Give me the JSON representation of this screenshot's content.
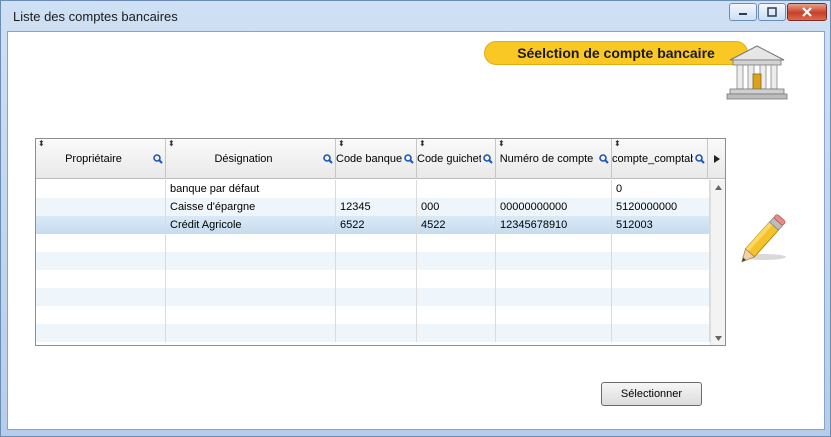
{
  "window": {
    "title": "Liste des comptes bancaires"
  },
  "banner": {
    "text": "Séelction de compte bancaire"
  },
  "grid": {
    "columns": [
      "Propriétaire",
      "Désignation",
      "Code banque",
      "Code guichet",
      "Numéro de compte",
      "compte_comptable"
    ],
    "rows": [
      [
        "",
        "banque par défaut",
        "",
        "",
        "",
        "0"
      ],
      [
        "",
        "Caisse d'épargne",
        "12345",
        "000",
        "00000000000",
        "5120000000"
      ],
      [
        "",
        "Crédit Agricole",
        "6522",
        "4522",
        "12345678910",
        "512003"
      ]
    ],
    "selected_row": 2
  },
  "buttons": {
    "select": "Sélectionner"
  },
  "icons": [
    "minimize-icon",
    "maximize-icon",
    "close-icon",
    "bank-icon",
    "pencil-icon",
    "sort-icon",
    "search-icon",
    "arrow-right-icon",
    "arrow-up-icon",
    "arrow-down-icon"
  ]
}
